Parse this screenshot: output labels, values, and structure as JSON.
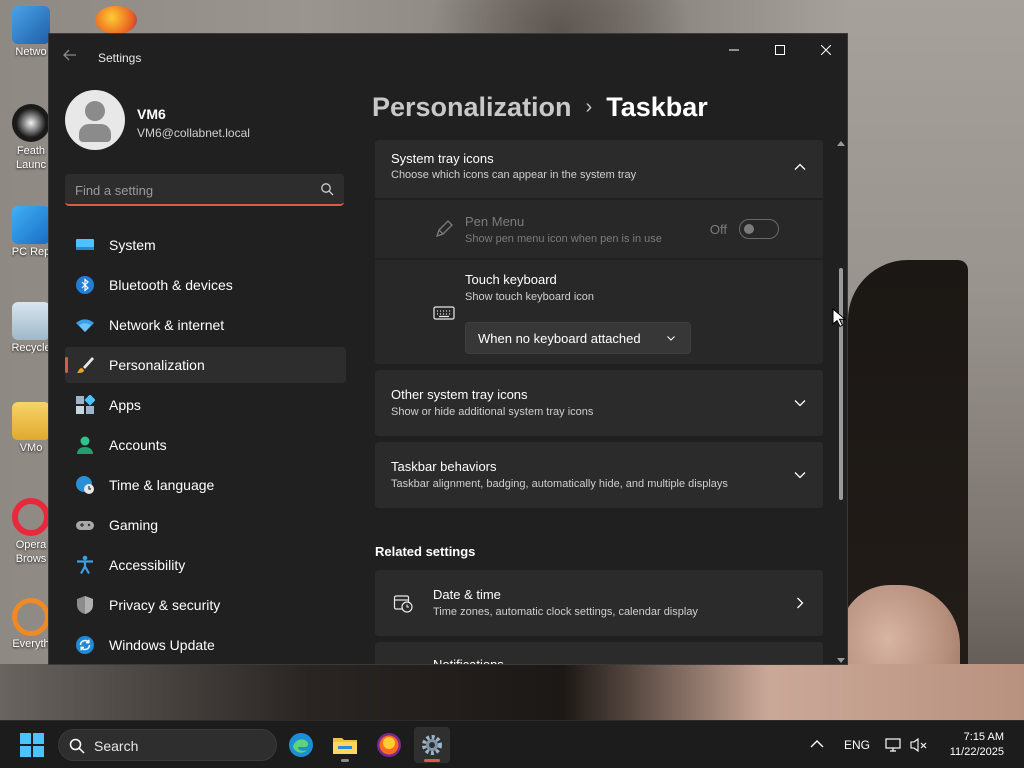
{
  "desktop": {
    "icons": [
      {
        "label": "Netwo",
        "icon": "network-icon"
      },
      {
        "label": "Feath Launc",
        "icon": "feather-launcher-icon"
      },
      {
        "label": "PC Rep",
        "icon": "pc-repair-icon"
      },
      {
        "label": "Recycle",
        "icon": "recycle-bin-icon"
      },
      {
        "label": "VMo",
        "icon": "folder-icon"
      },
      {
        "label": "Opera Brows",
        "icon": "opera-browser-icon"
      },
      {
        "label": "Everyth",
        "icon": "everything-icon"
      }
    ]
  },
  "window": {
    "title": "Settings",
    "controls": {
      "minimize": "minimize-icon",
      "maximize": "maximize-icon",
      "close": "close-icon"
    }
  },
  "profile": {
    "name": "VM6",
    "email": "VM6@collabnet.local"
  },
  "search": {
    "placeholder": "Find a setting"
  },
  "sidebar": {
    "items": [
      {
        "label": "System",
        "icon": "monitor-icon"
      },
      {
        "label": "Bluetooth & devices",
        "icon": "bluetooth-icon"
      },
      {
        "label": "Network & internet",
        "icon": "wifi-icon"
      },
      {
        "label": "Personalization",
        "icon": "brush-icon",
        "active": true
      },
      {
        "label": "Apps",
        "icon": "apps-icon"
      },
      {
        "label": "Accounts",
        "icon": "person-icon"
      },
      {
        "label": "Time & language",
        "icon": "globe-clock-icon"
      },
      {
        "label": "Gaming",
        "icon": "gamepad-icon"
      },
      {
        "label": "Accessibility",
        "icon": "accessibility-icon"
      },
      {
        "label": "Privacy & security",
        "icon": "shield-icon"
      },
      {
        "label": "Windows Update",
        "icon": "update-icon"
      }
    ]
  },
  "breadcrumb": {
    "parent": "Personalization",
    "separator": "›",
    "current": "Taskbar"
  },
  "main": {
    "system_tray": {
      "title": "System tray icons",
      "subtitle": "Choose which icons can appear in the system tray",
      "expanded": true,
      "items": [
        {
          "title": "Pen Menu",
          "subtitle": "Show pen menu icon when pen is in use",
          "state_label": "Off",
          "enabled": false,
          "icon": "pen-icon"
        },
        {
          "title": "Touch keyboard",
          "subtitle": "Show touch keyboard icon",
          "dropdown_value": "When no keyboard attached",
          "icon": "keyboard-icon"
        }
      ]
    },
    "other_tray": {
      "title": "Other system tray icons",
      "subtitle": "Show or hide additional system tray icons"
    },
    "behaviors": {
      "title": "Taskbar behaviors",
      "subtitle": "Taskbar alignment, badging, automatically hide, and multiple displays"
    },
    "related_heading": "Related settings",
    "related": [
      {
        "title": "Date & time",
        "subtitle": "Time zones, automatic clock settings, calendar display",
        "icon": "clock-calendar-icon"
      },
      {
        "title": "Notifications",
        "icon": "bell-icon"
      }
    ]
  },
  "taskbar": {
    "search_label": "Search",
    "apps": [
      {
        "name": "edge",
        "icon": "edge-icon"
      },
      {
        "name": "file-explorer",
        "icon": "folder-icon"
      },
      {
        "name": "firefox",
        "icon": "firefox-icon"
      },
      {
        "name": "settings",
        "icon": "settings-gear-icon",
        "active": true
      }
    ],
    "language": "ENG",
    "time": "7:15 AM",
    "date": "11/22/2025"
  },
  "colors": {
    "accent": "#e05a43",
    "window_bg": "#202020",
    "card_bg": "#2b2b2b"
  }
}
